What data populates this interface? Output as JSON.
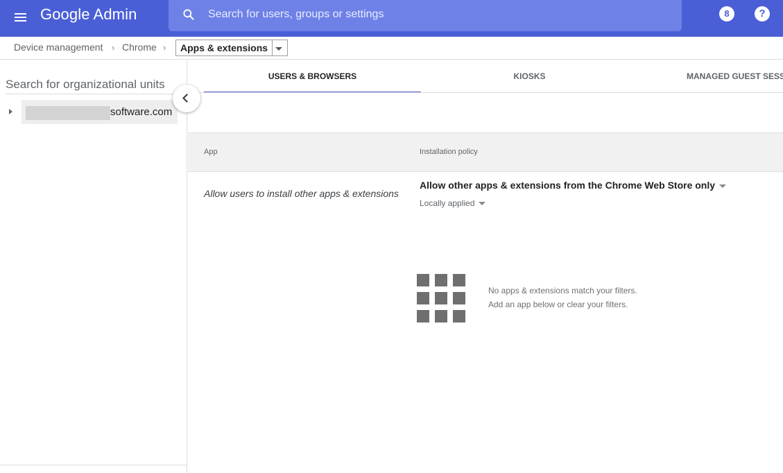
{
  "appbar": {
    "brand": "Google Admin",
    "search_placeholder": "Search for users, groups or settings",
    "badge_text": "8",
    "help_text": "?"
  },
  "breadcrumb": {
    "items": [
      "Device management",
      "Chrome"
    ],
    "separator": "›",
    "current": "Apps & extensions"
  },
  "left_panel": {
    "search_placeholder": "Search for organizational units",
    "org_unit_label": "software.com"
  },
  "tabs": [
    "USERS & BROWSERS",
    "KIOSKS",
    "MANAGED GUEST SESSIONS"
  ],
  "table": {
    "col_app": "App",
    "col_policy": "Installation policy"
  },
  "policy": {
    "name": "Allow users to install other apps & extensions",
    "value": "Allow other apps & extensions from the Chrome Web Store only",
    "scope": "Locally applied"
  },
  "empty_state": {
    "line1": "No apps & extensions match your filters.",
    "line2": "Add an app below or clear your filters."
  },
  "colors": {
    "appbar": "#4a5fd6",
    "search_box": "#6e81e6",
    "accent": "#4a5fd6"
  }
}
